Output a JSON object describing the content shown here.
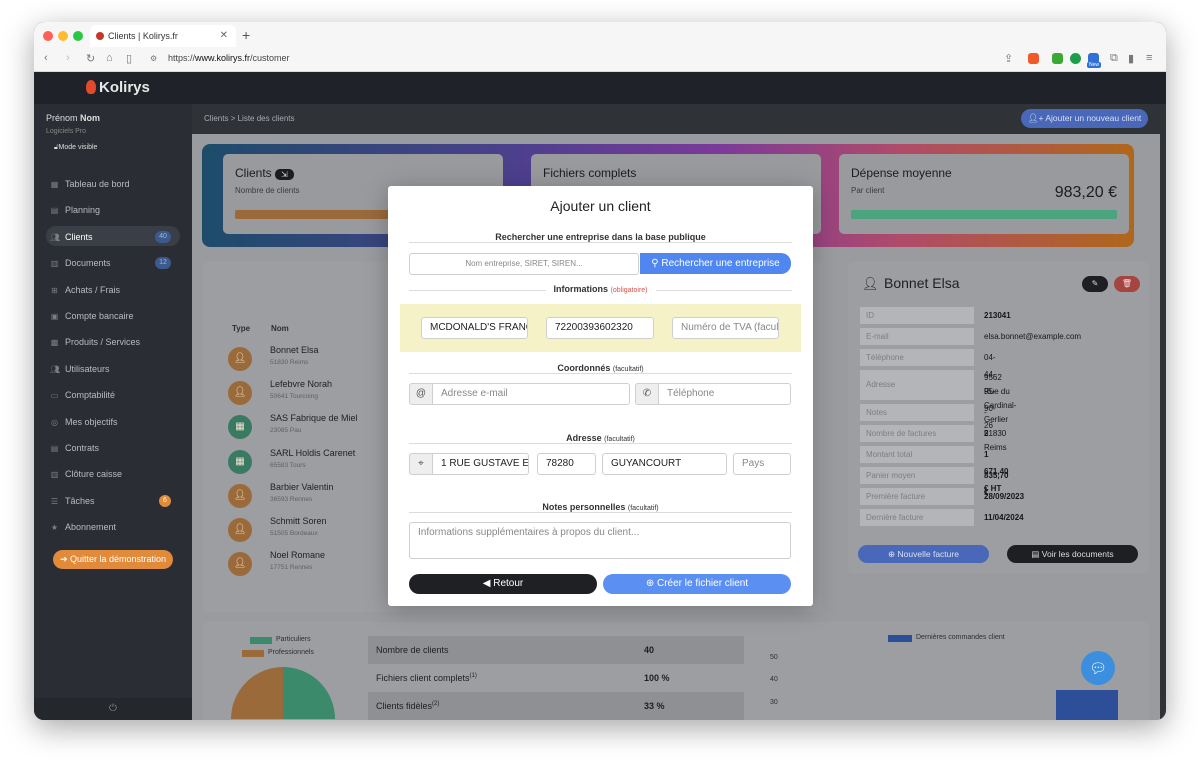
{
  "browser": {
    "tab_title": "Clients | Kolirys.fr",
    "url_prefix": "https://",
    "url_host": "www.kolirys.fr",
    "url_path": "/customer",
    "ext_new_label": "New"
  },
  "app": {
    "logo": "Kolirys",
    "user_first": "Prénom",
    "user_last": "Nom",
    "user_sub": "Logiciels Pro",
    "mode": "Mode visible"
  },
  "sidebar": {
    "items": [
      {
        "label": "Tableau de bord",
        "icon": "dashboard-icon"
      },
      {
        "label": "Planning",
        "icon": "calendar-icon"
      },
      {
        "label": "Clients",
        "icon": "users-icon",
        "badge": "40"
      },
      {
        "label": "Documents",
        "icon": "document-icon",
        "badge": "12"
      },
      {
        "label": "Achats / Frais",
        "icon": "cart-icon"
      },
      {
        "label": "Compte bancaire",
        "icon": "bank-icon"
      },
      {
        "label": "Produits / Services",
        "icon": "box-icon"
      },
      {
        "label": "Utilisateurs",
        "icon": "user-group-icon"
      },
      {
        "label": "Comptabilité",
        "icon": "accounting-icon"
      },
      {
        "label": "Mes objectifs",
        "icon": "target-icon"
      },
      {
        "label": "Contrats",
        "icon": "contract-icon"
      },
      {
        "label": "Clôture caisse",
        "icon": "register-icon"
      },
      {
        "label": "Tâches",
        "icon": "tasks-icon",
        "badge": "6"
      },
      {
        "label": "Abonnement",
        "icon": "star-icon"
      }
    ],
    "quit_label": "Quitter la démonstration"
  },
  "header": {
    "breadcrumb_root": "Clients",
    "breadcrumb_sep": ">",
    "breadcrumb_current": "Liste des clients",
    "add_client_label": "Ajouter un nouveau client"
  },
  "cards": {
    "clients_title": "Clients",
    "clients_sub": "Nombre de clients",
    "files_title": "Fichiers complets",
    "spend_title": "Dépense moyenne",
    "spend_sub": "Par client",
    "spend_value": "983,20 €"
  },
  "client_table": {
    "col_type": "Type",
    "col_name": "Nom",
    "rows": [
      {
        "name": "Bonnet Elsa",
        "city": "51830 Reims",
        "kind": "person"
      },
      {
        "name": "Lefebvre Norah",
        "city": "50641 Tourcoing",
        "kind": "person"
      },
      {
        "name": "SAS Fabrique de Miel",
        "city": "23085 Pau",
        "kind": "company"
      },
      {
        "name": "SARL Holdis Carenet",
        "city": "65583 Tours",
        "kind": "company"
      },
      {
        "name": "Barbier Valentin",
        "city": "36593 Rennes",
        "kind": "person"
      },
      {
        "name": "Schmitt Soren",
        "city": "51505 Bordeaux",
        "kind": "person"
      },
      {
        "name": "Noel Romane",
        "city": "17751 Rennes",
        "kind": "person"
      }
    ]
  },
  "detail": {
    "name": "Bonnet Elsa",
    "fields": [
      {
        "k": "ID",
        "v": "213041"
      },
      {
        "k": "E-mail",
        "v": "elsa.bonnet@example.com"
      },
      {
        "k": "Téléphone",
        "v": "04-44-95-90-26"
      },
      {
        "k": "Adresse",
        "v": "9562 Rue du Cardinal-Gerlier",
        "v2": "51830 Reims"
      },
      {
        "k": "Notes",
        "v": "-"
      },
      {
        "k": "Nombre de factures",
        "v": "2"
      },
      {
        "k": "Montant total",
        "v": "1 671,40 € HT"
      },
      {
        "k": "Panier moyen",
        "v": "835,70 €"
      },
      {
        "k": "Première facture",
        "v": "28/09/2023"
      },
      {
        "k": "Dernière facture",
        "v": "11/04/2024"
      }
    ],
    "new_invoice_label": "Nouvelle facture",
    "view_docs_label": "Voir les documents"
  },
  "stats": {
    "legend_individuals": "Particuliers",
    "legend_pros": "Professionnels",
    "rows": [
      {
        "k": "Nombre de clients",
        "sup": "",
        "v": "40"
      },
      {
        "k": "Fichiers client complets",
        "sup": "(1)",
        "v": "100 %"
      },
      {
        "k": "Clients fidèles",
        "sup": "(2)",
        "v": "33 %"
      }
    ],
    "bar_legend": "Dernières commandes client",
    "y_ticks": [
      "50",
      "40",
      "30",
      "20"
    ]
  },
  "modal": {
    "title": "Ajouter un client",
    "search_section": "Rechercher une entreprise dans la base publique",
    "search_placeholder": "Nom entreprise, SIRET, SIREN...",
    "search_button": "Rechercher une entreprise",
    "info_section": "Informations",
    "info_required": "(obligatoire)",
    "company_name": "MCDONALD'S FRANCE",
    "siret": "72200393602320",
    "vat_placeholder": "Numéro de TVA (facultatif)",
    "contact_section": "Coordonnés",
    "optional": "(facultatif)",
    "email_placeholder": "Adresse e-mail",
    "phone_placeholder": "Téléphone",
    "address_section": "Adresse",
    "street": "1 RUE GUSTAVE EIFFEL",
    "zip": "78280",
    "city": "GUYANCOURT",
    "country_placeholder": "Pays",
    "notes_section": "Notes personnelles",
    "notes_placeholder": "Informations supplémentaires à propos du client...",
    "back_button": "Retour",
    "create_button": "Créer le fichier client"
  },
  "colors": {
    "accent_blue": "#4f86f0",
    "info_highlight": "#f6f2c8",
    "person_avatar": "#d9853b",
    "company_avatar": "#3daa7d",
    "danger": "#d9534f"
  }
}
